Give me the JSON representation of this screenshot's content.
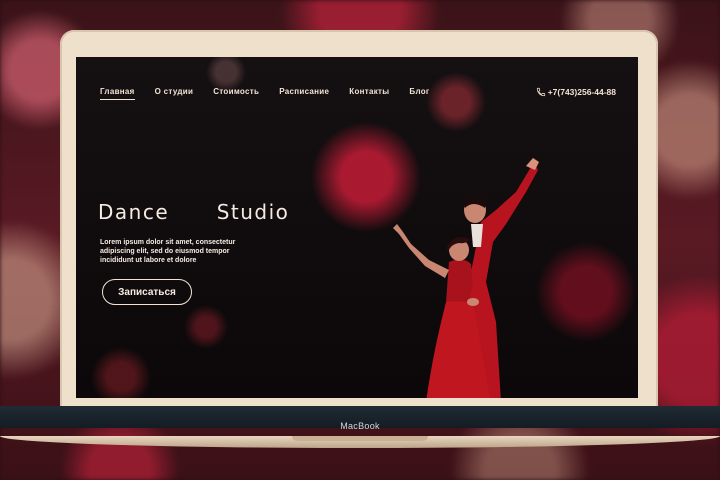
{
  "nav": {
    "items": [
      {
        "label": "Главная",
        "active": true
      },
      {
        "label": "О студии",
        "active": false
      },
      {
        "label": "Стоимость",
        "active": false
      },
      {
        "label": "Расписание",
        "active": false
      },
      {
        "label": "Контакты",
        "active": false
      },
      {
        "label": "Блог",
        "active": false
      }
    ],
    "phone": "+7(743)256-44-88",
    "phone_icon": "phone-icon"
  },
  "hero": {
    "title": "Dance   Studio",
    "text": "Lorem ipsum dolor sit amet, consectetur adipiscing elit, sed do eiusmod tempor incididunt ut labore et dolore",
    "cta_label": "Записаться"
  },
  "device": {
    "label": "MacBook"
  },
  "colors": {
    "accent": "#d81e3c",
    "text": "#f3e3d5",
    "bezel": "#efe0cb"
  }
}
